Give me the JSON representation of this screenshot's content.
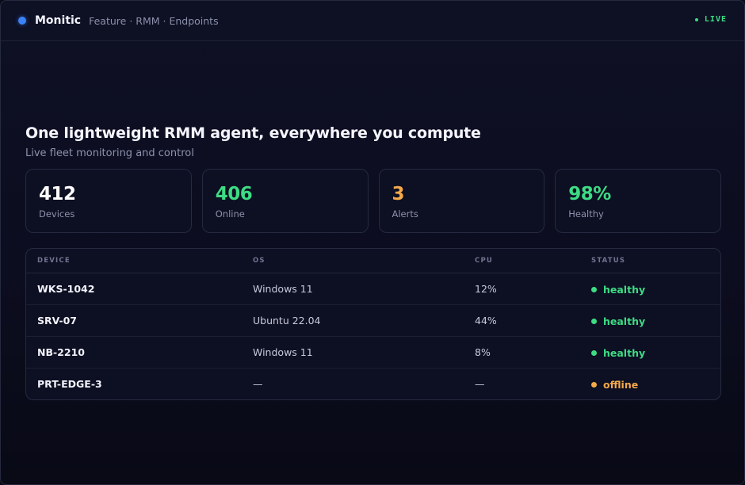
{
  "topbar": {
    "brand": "Monitic",
    "breadcrumb": "Feature · RMM · Endpoints",
    "live_label": "LIVE",
    "brand_dot_color": "#3b82f6",
    "live_color": "#3ddc84"
  },
  "hero": {
    "title": "One lightweight RMM agent, everywhere you compute",
    "subtitle": "Live fleet monitoring and control"
  },
  "stats": [
    {
      "value": "412",
      "label": "Devices",
      "color": "#ffffff"
    },
    {
      "value": "406",
      "label": "Online",
      "color": "#3ddc84"
    },
    {
      "value": "3",
      "label": "Alerts",
      "color": "#f5a94a"
    },
    {
      "value": "98%",
      "label": "Healthy",
      "color": "#3ddc84"
    }
  ],
  "table": {
    "columns": [
      "DEVICE",
      "OS",
      "CPU",
      "STATUS"
    ],
    "rows": [
      {
        "device": "WKS-1042",
        "os": "Windows 11",
        "cpu": "12%",
        "status": "healthy",
        "status_color": "#3ddc84"
      },
      {
        "device": "SRV-07",
        "os": "Ubuntu 22.04",
        "cpu": "44%",
        "status": "healthy",
        "status_color": "#3ddc84"
      },
      {
        "device": "NB-2210",
        "os": "Windows 11",
        "cpu": "8%",
        "status": "healthy",
        "status_color": "#3ddc84"
      },
      {
        "device": "PRT-EDGE-3",
        "os": "—",
        "cpu": "—",
        "status": "offline",
        "status_color": "#f5a94a"
      }
    ]
  }
}
